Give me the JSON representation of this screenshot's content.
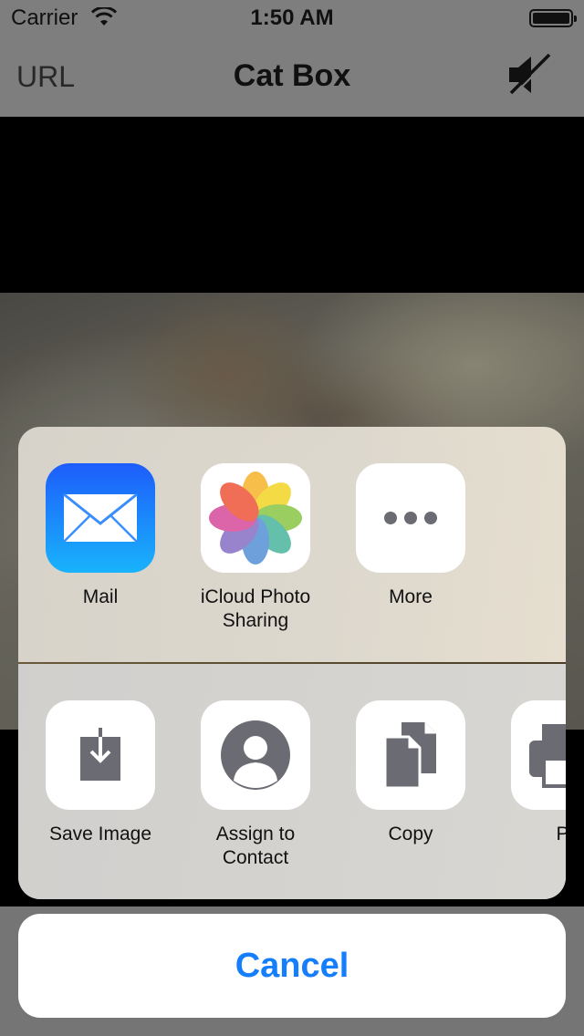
{
  "status_bar": {
    "carrier": "Carrier",
    "time": "1:50 AM"
  },
  "nav_bar": {
    "left_button": "URL",
    "title": "Cat Box",
    "right_icon": "mute-speaker-icon"
  },
  "share_sheet": {
    "apps": [
      {
        "label": "Mail",
        "icon": "mail-icon"
      },
      {
        "label": "iCloud Photo\nSharing",
        "icon": "photos-icon"
      },
      {
        "label": "More",
        "icon": "more-icon"
      }
    ],
    "actions": [
      {
        "label": "Save Image",
        "icon": "save-image-icon"
      },
      {
        "label": "Assign to\nContact",
        "icon": "contact-icon"
      },
      {
        "label": "Copy",
        "icon": "copy-icon"
      },
      {
        "label": "Pr",
        "icon": "print-icon"
      }
    ],
    "cancel_label": "Cancel"
  },
  "colors": {
    "accent": "#147efb",
    "mail_gradient_top": "#1d5dfb",
    "mail_gradient_bottom": "#19b3fb",
    "action_glyph": "#6b6b73"
  }
}
